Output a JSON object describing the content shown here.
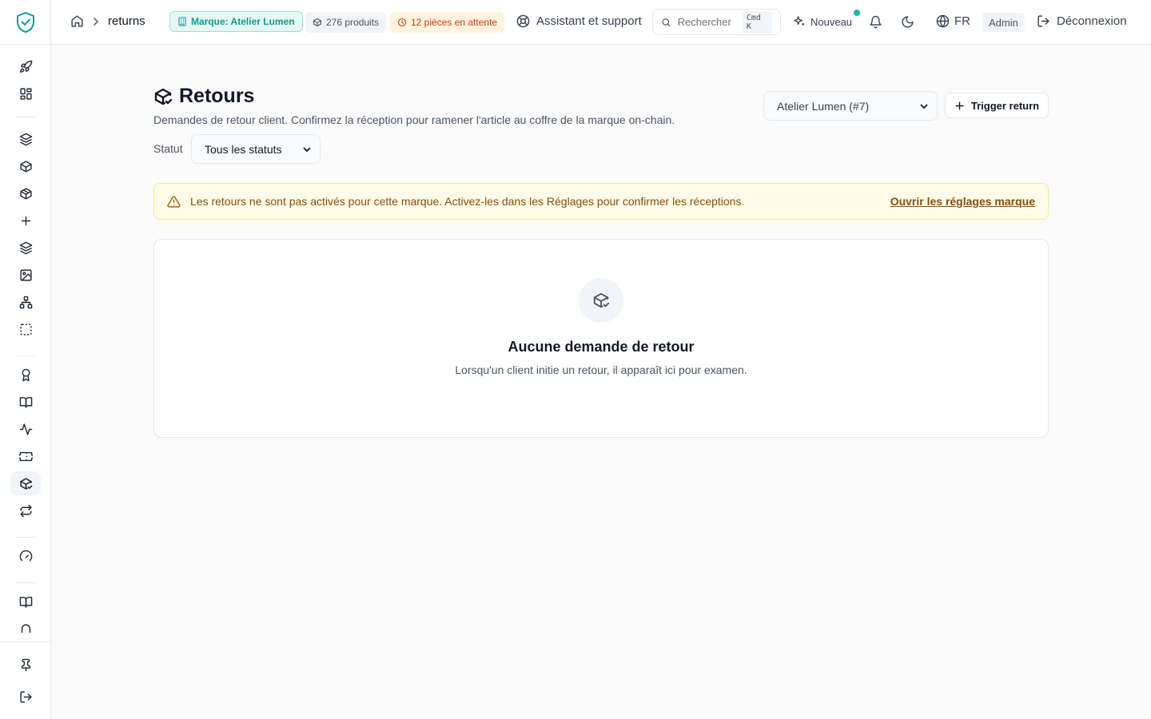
{
  "app": {
    "brand_color": "#0f9b8e",
    "accent_dot": "#14b8a6"
  },
  "sidebar": {
    "items": [
      {
        "icon": "rocket-icon"
      },
      {
        "icon": "dashboard-grid-icon"
      },
      {
        "icon": "layers-icon"
      },
      {
        "icon": "box-icon"
      },
      {
        "icon": "box-icon"
      },
      {
        "icon": "plus-icon"
      },
      {
        "icon": "layers-icon"
      },
      {
        "icon": "image-icon"
      },
      {
        "icon": "sitemap-icon"
      },
      {
        "icon": "dashed-square-icon"
      },
      {
        "icon": "award-icon"
      },
      {
        "icon": "book-icon"
      },
      {
        "icon": "activity-icon"
      },
      {
        "icon": "ticket-icon"
      },
      {
        "icon": "package-check-icon",
        "active": true
      },
      {
        "icon": "repeat-icon"
      },
      {
        "icon": "gauge-icon"
      },
      {
        "icon": "book-icon"
      },
      {
        "icon": "arch-icon"
      }
    ],
    "bottom": [
      {
        "icon": "pin-icon"
      },
      {
        "icon": "logout-icon"
      }
    ]
  },
  "header": {
    "breadcrumb": {
      "home_icon": "home-icon",
      "current": "returns"
    },
    "brand_pill": "Marque: Atelier Lumen",
    "products_pill": "276 produits",
    "pending_pill": "12 pièces en attente",
    "support_label": "Assistant et support",
    "search": {
      "placeholder": "Rechercher",
      "shortcut": "Cmd K"
    },
    "new_label": "Nouveau",
    "language": "FR",
    "role_badge": "Admin",
    "logout_label": "Déconnexion"
  },
  "page": {
    "title": "Retours",
    "subtitle": "Demandes de retour client. Confirmez la réception pour ramener l'article au coffre de la marque on-chain.",
    "brand_select": "Atelier Lumen (#7)",
    "trigger_button": "Trigger return",
    "status_filter": {
      "label": "Statut",
      "value": "Tous les statuts"
    }
  },
  "alert": {
    "text": "Les retours ne sont pas activés pour cette marque. Activez-les dans les Réglages pour confirmer les réceptions.",
    "link": "Ouvrir les réglages marque"
  },
  "empty_state": {
    "title": "Aucune demande de retour",
    "description": "Lorsqu'un client initie un retour, il apparaît ici pour examen."
  }
}
